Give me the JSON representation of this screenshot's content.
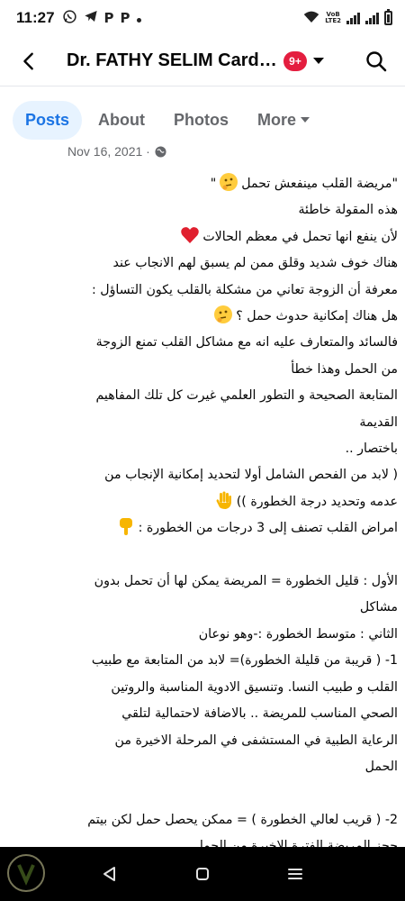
{
  "status_bar": {
    "time": "11:27",
    "left_glyphs": [
      "P",
      "P"
    ],
    "network_label_top": "VoB",
    "network_label_bottom": "LTE2"
  },
  "header": {
    "title": "Dr. FATHY SELIM Cardi...",
    "badge": "9+"
  },
  "tabs": [
    {
      "label": "Posts",
      "active": true
    },
    {
      "label": "About",
      "active": false
    },
    {
      "label": "Photos",
      "active": false
    },
    {
      "label": "More",
      "active": false
    }
  ],
  "post": {
    "date": "Nov 16, 2021 ·",
    "lines": [
      "\"مريضة القلب مينفعش تحمل",
      "هذه المقولة خاطئة",
      "لأن ينفع انها  تحمل في معظم الحالات",
      "هناك خوف شديد وقلق ممن  لم يسبق لهم الانجاب  عند",
      "معرفة أن الزوجة تعاني من مشكلة بالقلب يكون التساؤل :",
      "هل هناك إمكانية حدوث حمل ؟",
      "فالسائد والمتعارف عليه انه مع مشاكل القلب تمنع الزوجة",
      "من  الحمل وهذا خطأ",
      "المتابعة الصحيحة و التطور العلمي غيرت كل تلك المفاهيم",
      "القديمة",
      "باختصار ..",
      "( لابد من  الفحص الشامل أولا لتحديد إمكانية الإنجاب من",
      "عدمه وتحديد درجة الخطورة ))",
      "امراض القلب تصنف إلى 3 درجات من الخطورة :",
      "",
      "الأول : قليل الخطورة = المريضة يمكن لها أن تحمل بدون",
      "مشاكل",
      "الثاني : متوسط الخطورة :-وهو نوعان",
      "1-  ( قريبة من قليلة الخطورة)= لابد من المتابعة مع طبيب",
      "القلب و طبيب النسا. وتنسيق الادوية المناسبة والروتين",
      "الصحي المناسب للمريضة .. بالاضافة لاحتمالية لتلقي",
      "الرعاية  الطبية في المستشفى  في المرحلة الاخيرة من",
      "الحمل",
      "",
      "2- ( قريب لعالي الخطورة ) = ممكن يحصل حمل لكن بيتم",
      "حجز المريضة الفترة الاخيرة من الحمل"
    ]
  },
  "colors": {
    "accent": "#1b74e4",
    "tab_active_bg": "#e7f3ff",
    "badge": "#e41e3f",
    "muted": "#65676b"
  }
}
